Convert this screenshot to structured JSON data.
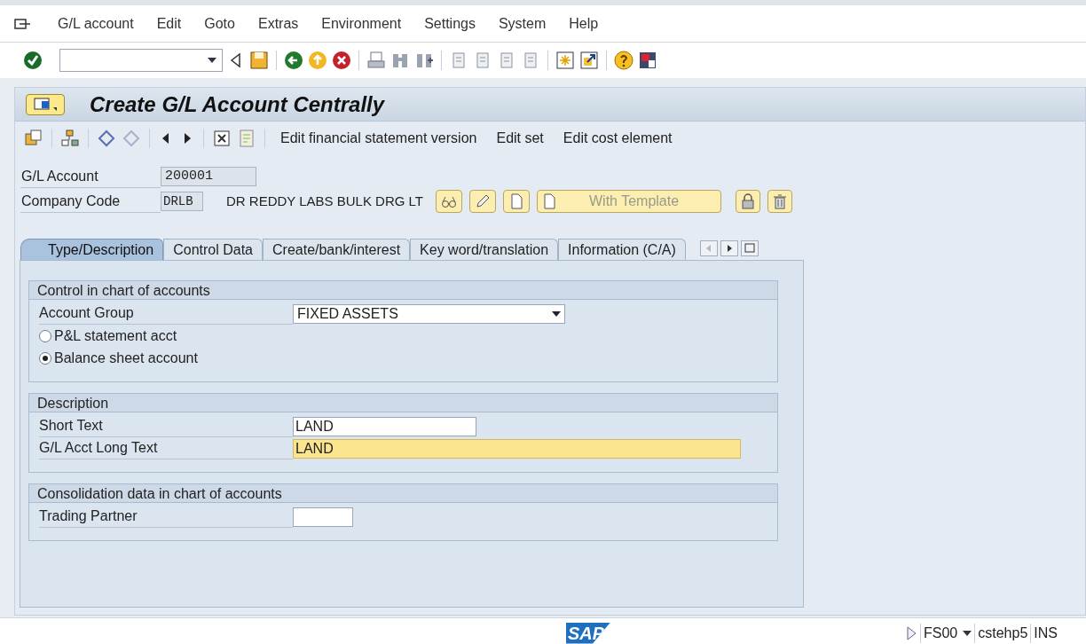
{
  "menu": [
    "G/L account",
    "Edit",
    "Goto",
    "Extras",
    "Environment",
    "Settings",
    "System",
    "Help"
  ],
  "title": "Create G/L Account Centrally",
  "app_toolbar": [
    "Edit financial statement version",
    "Edit set",
    "Edit cost element"
  ],
  "header": {
    "gl_account": {
      "label": "G/L Account",
      "value": "200001"
    },
    "company_code": {
      "label": "Company Code",
      "value": "DRLB",
      "name": "DR REDDY LABS BULK DRG LT"
    },
    "template_button": "With Template"
  },
  "tabs": [
    {
      "label": "Type/Description",
      "selected": true
    },
    {
      "label": "Control Data",
      "selected": false
    },
    {
      "label": "Create/bank/interest",
      "selected": false
    },
    {
      "label": "Key word/translation",
      "selected": false
    },
    {
      "label": "Information (C/A)",
      "selected": false
    }
  ],
  "groups": [
    {
      "title": "Control in chart of accounts",
      "rows": [
        {
          "kind": "dropdown",
          "label": "Account Group",
          "value": "FIXED ASSETS"
        },
        {
          "kind": "radio",
          "label": "P&L statement acct",
          "selected": false
        },
        {
          "kind": "radio",
          "label": "Balance sheet account",
          "selected": true
        }
      ]
    },
    {
      "title": "Description",
      "rows": [
        {
          "kind": "input",
          "label": "Short Text",
          "value": "LAND",
          "focused": false
        },
        {
          "kind": "input",
          "label": "G/L Acct Long Text",
          "value": "LAND",
          "focused": true
        }
      ]
    },
    {
      "title": "Consolidation data in chart of accounts",
      "rows": [
        {
          "kind": "input",
          "label": "Trading Partner",
          "focused": false
        }
      ]
    }
  ],
  "status_bar": {
    "logo": "SAP",
    "transaction": "FS00",
    "system": "cstehp5",
    "mode": "INS"
  }
}
